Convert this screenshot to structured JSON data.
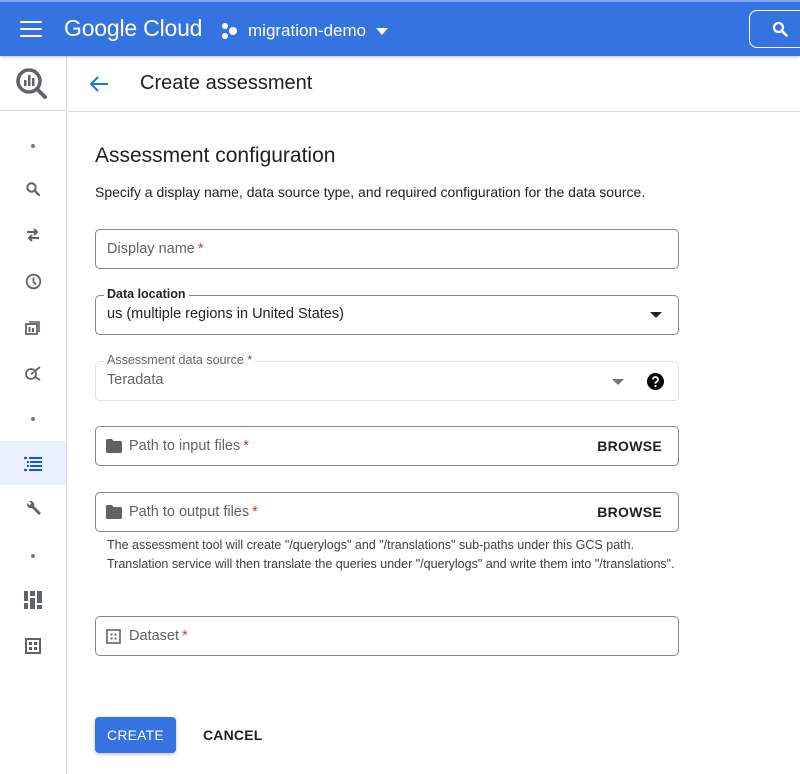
{
  "topbar": {
    "brand": "Google Cloud",
    "project": "migration-demo",
    "accent_color": "#3574e0"
  },
  "sidebar": {
    "product_icon": "bigquery-icon",
    "items": [
      {
        "icon": "dot",
        "active": false
      },
      {
        "icon": "search-icon",
        "active": false
      },
      {
        "icon": "transfer-icon",
        "active": false
      },
      {
        "icon": "clock-icon",
        "active": false
      },
      {
        "icon": "analytics-hub-icon",
        "active": false
      },
      {
        "icon": "dataflow-icon",
        "active": false
      },
      {
        "icon": "dot",
        "active": false
      },
      {
        "icon": "list-icon",
        "active": true
      },
      {
        "icon": "wrench-icon",
        "active": false
      },
      {
        "icon": "dot",
        "active": false
      },
      {
        "icon": "dashboard-icon",
        "active": false
      },
      {
        "icon": "table-icon",
        "active": false
      }
    ]
  },
  "header": {
    "title": "Create assessment"
  },
  "form": {
    "heading": "Assessment configuration",
    "description": "Specify a display name, data source type, and required configuration for the data source.",
    "display_name": {
      "placeholder": "Display name",
      "required": "*",
      "value": ""
    },
    "data_location": {
      "label": "Data location",
      "value": "us (multiple regions in United States)"
    },
    "data_source": {
      "label": "Assessment data source *",
      "value": "Teradata",
      "disabled": true
    },
    "input_path": {
      "placeholder": "Path to input files",
      "required": "*",
      "action": "BROWSE"
    },
    "output_path": {
      "placeholder": "Path to output files",
      "required": "*",
      "action": "BROWSE"
    },
    "output_help": "The assessment tool will create \"/querylogs\" and \"/translations\" sub-paths under this GCS path. Translation service will then translate the queries under \"/querylogs\" and write them into \"/translations\".",
    "dataset": {
      "placeholder": "Dataset",
      "required": "*"
    },
    "create_label": "CREATE",
    "cancel_label": "CANCEL"
  }
}
